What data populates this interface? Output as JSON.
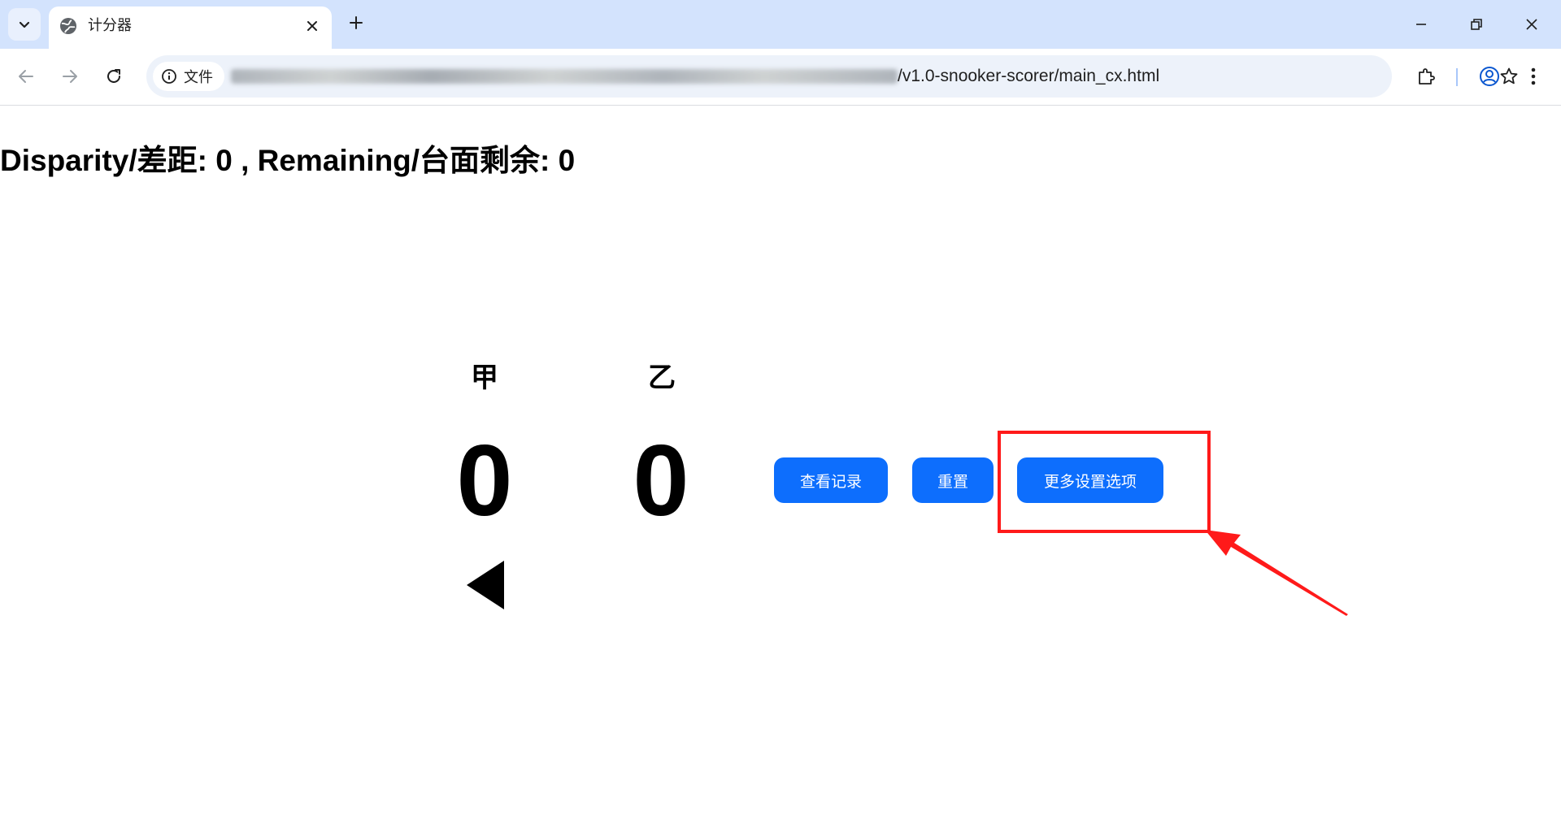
{
  "browser": {
    "tab_title": "计分器",
    "site_chip_label": "文件",
    "url_visible": "/v1.0-snooker-scorer/main_cx.html"
  },
  "page": {
    "status_line": "Disparity/差距: 0 , Remaining/台面剩余: 0",
    "players": [
      {
        "name": "甲",
        "score": "0"
      },
      {
        "name": "乙",
        "score": "0"
      }
    ],
    "buttons": {
      "history": "查看记录",
      "reset": "重置",
      "more_settings": "更多设置选项"
    }
  },
  "colors": {
    "button_blue": "#0d6efd",
    "annotation_red": "#ff1a1a",
    "tabbar_blue": "#d3e3fd"
  }
}
